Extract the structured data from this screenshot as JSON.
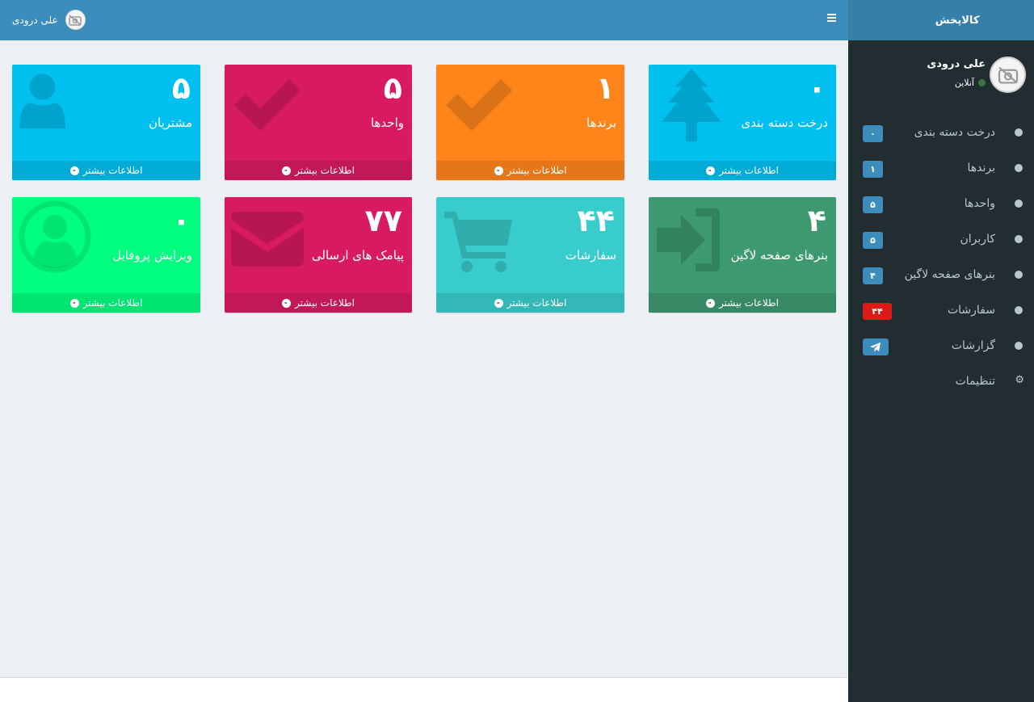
{
  "sidebar": {
    "brand": "کالاپخش",
    "user_name": "علی درودی",
    "user_status": "آنلاین",
    "items": [
      {
        "label": "درخت دسته بندی",
        "badge": "۰",
        "icon": "circle-icon"
      },
      {
        "label": "برندها",
        "badge": "۱",
        "icon": "circle-icon"
      },
      {
        "label": "واحدها",
        "badge": "۵",
        "icon": "circle-icon"
      },
      {
        "label": "کاربران",
        "badge": "۵",
        "icon": "circle-icon"
      },
      {
        "label": "بنرهای صفحه لاگین",
        "badge": "۴",
        "icon": "circle-icon"
      },
      {
        "label": "سفارشات",
        "badge": "۴۴",
        "icon": "circle-icon",
        "badge_color": "#dd1b16"
      },
      {
        "label": "گزارشات",
        "badge_icon": "paper-plane-icon",
        "icon": "circle-icon"
      },
      {
        "label": "تنظیمات",
        "icon": "gear-icon"
      }
    ]
  },
  "header": {
    "user_name": "علی درودی",
    "menu_icon": "hamburger-icon"
  },
  "more_info_label": "اطلاعات بیشتر",
  "cards": [
    {
      "value": "۰",
      "label": "درخت دسته بندی",
      "icon": "tree-icon",
      "color": "#00c0ef"
    },
    {
      "value": "۱",
      "label": "برندها",
      "icon": "check-icon",
      "color": "#ff851b"
    },
    {
      "value": "۵",
      "label": "واحدها",
      "icon": "check-icon",
      "color": "#d81b60"
    },
    {
      "value": "۵",
      "label": "مشتریان",
      "icon": "user-icon",
      "color": "#00c0ef"
    },
    {
      "value": "۴",
      "label": "بنرهای صفحه لاگین",
      "icon": "sign-in-icon",
      "color": "#3d9970"
    },
    {
      "value": "۴۴",
      "label": "سفارشات",
      "icon": "shopping-cart-icon",
      "color": "#39cccc"
    },
    {
      "value": "۷۷",
      "label": "پیامک های ارسالی",
      "icon": "envelope-icon",
      "color": "#d81b60"
    },
    {
      "value": "۰",
      "label": "ویرایش پروفایل",
      "icon": "user-circle-icon",
      "color": "#00ff7f"
    }
  ]
}
